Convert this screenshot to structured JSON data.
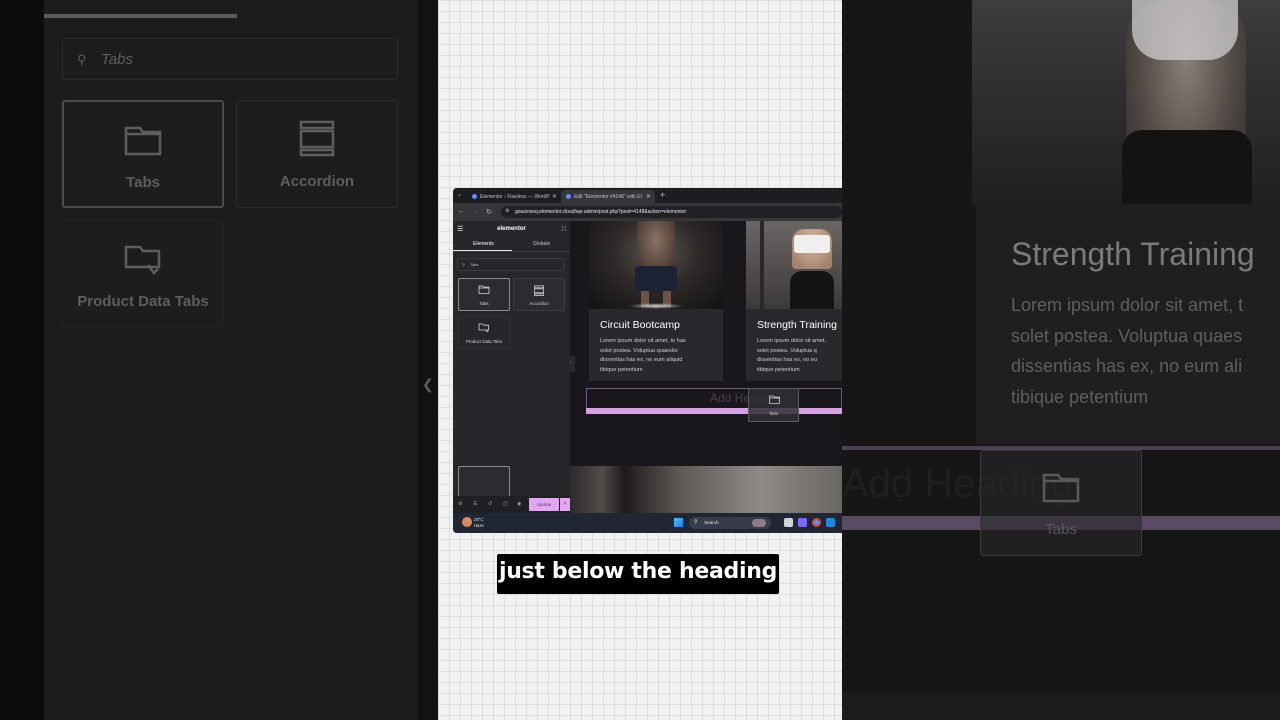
{
  "background_left": {
    "search_placeholder": "Tabs",
    "widgets": [
      {
        "label": "Tabs",
        "icon": "folder-tab-icon"
      },
      {
        "label": "Accordion",
        "icon": "accordion-icon"
      },
      {
        "label": "Product Data Tabs",
        "icon": "product-tabs-icon"
      }
    ]
  },
  "background_right": {
    "card_title": "Strength Training",
    "card_body": "Lorem ipsum dolor sit amet, t\nsolet postea. Voluptua quaes\ndissentias has ex, no eum ali\ntibique petentium",
    "ghost_text": "Add   Heading",
    "drag_label": "Tabs"
  },
  "browser": {
    "tabs": [
      {
        "label": "Elementor › Flawless — WordP"
      },
      {
        "label": "Edit \"Elementor #4148\" with El"
      }
    ],
    "new_tab": "+",
    "url": "gouizoxeq.elementor.cloud/wp-admin/post.php?post=4148&action=elementor"
  },
  "editor_panel": {
    "logo": "elementor",
    "tabs": [
      "Elements",
      "Globals"
    ],
    "search_value": "Tabs",
    "widgets": [
      {
        "label": "Tabs",
        "icon": "folder-tab-icon"
      },
      {
        "label": "Accordion",
        "icon": "accordion-icon"
      },
      {
        "label": "Product Data Tabs",
        "icon": "product-tabs-icon"
      }
    ],
    "update_label": "Update"
  },
  "preview": {
    "cards": [
      {
        "title": "Circuit Bootcamp",
        "body": "Lorem ipsum dolor sit amet, te has\nsolet postea. Voluptua quaestio\ndissentias has ex, no eum aliquid\ntibique petentium"
      },
      {
        "title": "Strength Training",
        "body": "Lorem ipsum dolor sit amet, \nsolet postea. Voluptua q\ndissentias has ex, no eu\ntibique petentium"
      }
    ],
    "ghost_text": "Add   Heading",
    "drag_label": "Tabs"
  },
  "taskbar": {
    "temperature": "28°C",
    "condition": "Haze",
    "search_label": "Search"
  },
  "caption": "just below the heading",
  "colors": {
    "accent_pink": "#e1a7f1",
    "panel_bg": "#26272b",
    "preview_bg": "#1a171c"
  }
}
